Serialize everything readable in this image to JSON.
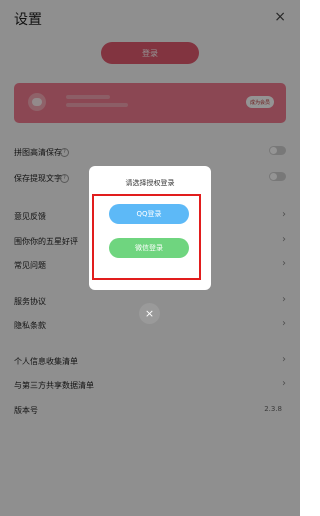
{
  "header": {
    "title": "设置",
    "close_glyph": "×"
  },
  "login_button": "登录",
  "banner": {
    "vip_label": "成为会员"
  },
  "settings": {
    "photo_save": "拼图高清保存",
    "save_watermark": "保存提现文字",
    "feedback": "意见反馈",
    "rate": "围你你的五星好评",
    "faq": "常见问题",
    "service_agreement": "服务协议",
    "privacy_policy": "隐私条款",
    "personal_info_list": "个人信息收集清单",
    "third_party_list": "与第三方共享数据清单",
    "version_label": "版本号",
    "version_value": "2.3.8"
  },
  "dialog": {
    "title": "请选择授权登录",
    "qq_button": "QQ登录",
    "wechat_button": "微信登录",
    "close_glyph": "×"
  },
  "icons": {
    "chevron": "›",
    "help": "?"
  }
}
